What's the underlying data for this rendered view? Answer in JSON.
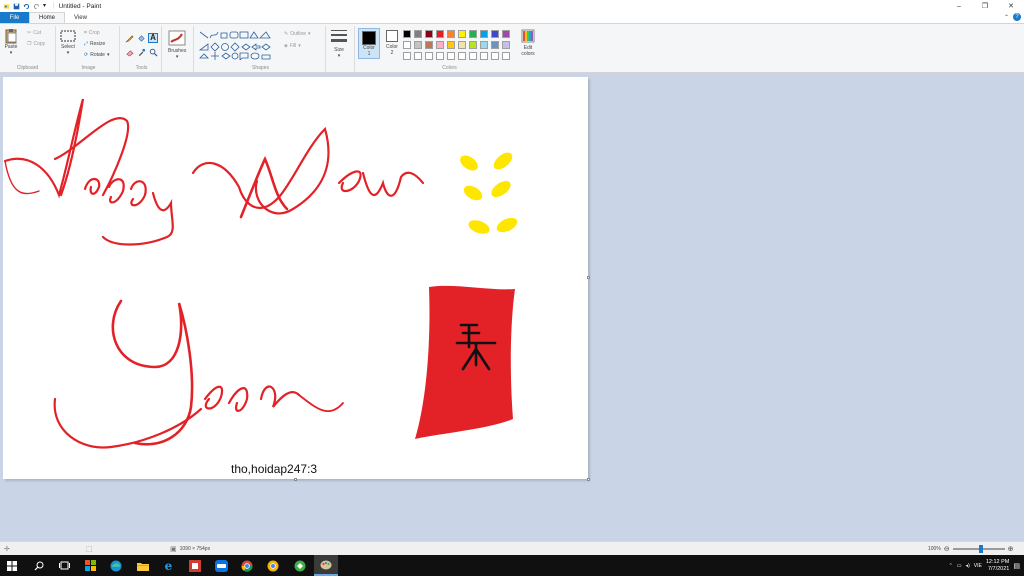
{
  "window": {
    "title": "Untitled - Paint",
    "controls": {
      "minimize": "–",
      "maximize": "❐",
      "close": "✕"
    }
  },
  "ribbon_tabs": [
    {
      "label": "File"
    },
    {
      "label": "Home"
    },
    {
      "label": "View"
    }
  ],
  "clipboard": {
    "paste": "Paste",
    "cut": "Cut",
    "copy": "Copy",
    "label": "Clipboard"
  },
  "image": {
    "select": "Select",
    "crop": "Crop",
    "resize": "Resize",
    "rotate": "Rotate",
    "label": "Image"
  },
  "tools": {
    "label": "Tools"
  },
  "brushes": {
    "label": "Brushes"
  },
  "shapes": {
    "outline": "Outline",
    "fill": "Fill",
    "label": "Shapes"
  },
  "size": {
    "label": "Size"
  },
  "colors": {
    "color1_label": "Color",
    "color1_num": "1",
    "color2_label": "Color",
    "color2_num": "2",
    "edit_label": "Edit",
    "edit_label2": "colors",
    "label": "Colors",
    "color1": "#000000",
    "color2": "#ffffff",
    "palette_row1": [
      "#000000",
      "#7f7f7f",
      "#880015",
      "#ed1c24",
      "#ff7f27",
      "#fff200",
      "#22b14c",
      "#00a2e8",
      "#3f48cc",
      "#a349a4"
    ],
    "palette_row2": [
      "#ffffff",
      "#c3c3c3",
      "#b97a57",
      "#ffaec9",
      "#ffc90e",
      "#efe4b0",
      "#b5e61d",
      "#99d9ea",
      "#7092be",
      "#c8bfe7"
    ]
  },
  "canvas": {
    "caption": "tho,hoidap247:3",
    "accent_red": "#e32228",
    "accent_yellow": "#ffe600"
  },
  "statusbar": {
    "dimensions": "1090 × 754px",
    "zoom": "100%"
  },
  "taskbar": {
    "language": "VIE",
    "time": "12:12 PM",
    "date": "7/7/2021"
  }
}
